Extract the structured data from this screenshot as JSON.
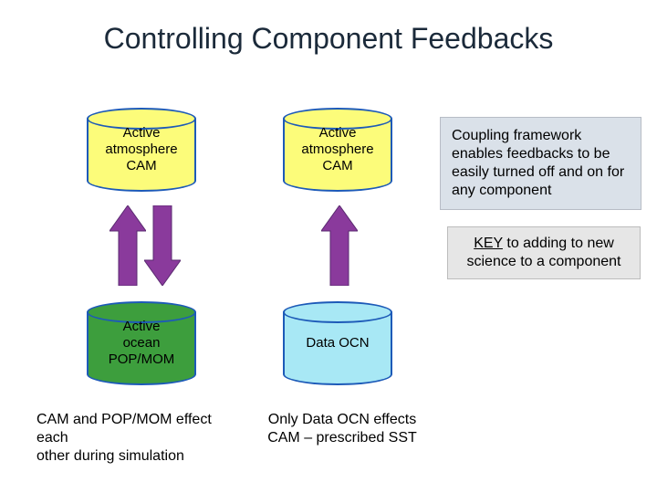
{
  "title": "Controlling Component Feedbacks",
  "cyl": {
    "atm1": "Active\natmosphere\nCAM",
    "atm2": "Active\natmosphere\nCAM",
    "ocn_active": "Active\nocean\nPOP/MOM",
    "ocn_data": "Data OCN"
  },
  "side": {
    "coupling": "Coupling framework enables feedbacks to be easily turned off and on for any component"
  },
  "key": {
    "prefix": "KEY",
    "rest": " to adding to new science to a component"
  },
  "captions": {
    "left": "CAM and POP/MOM effect each\nother during simulation",
    "right": "Only Data OCN effects CAM – prescribed SST"
  },
  "colors": {
    "arrow_purple": "#8a3a9c",
    "arrow_border": "#5a2a70"
  }
}
